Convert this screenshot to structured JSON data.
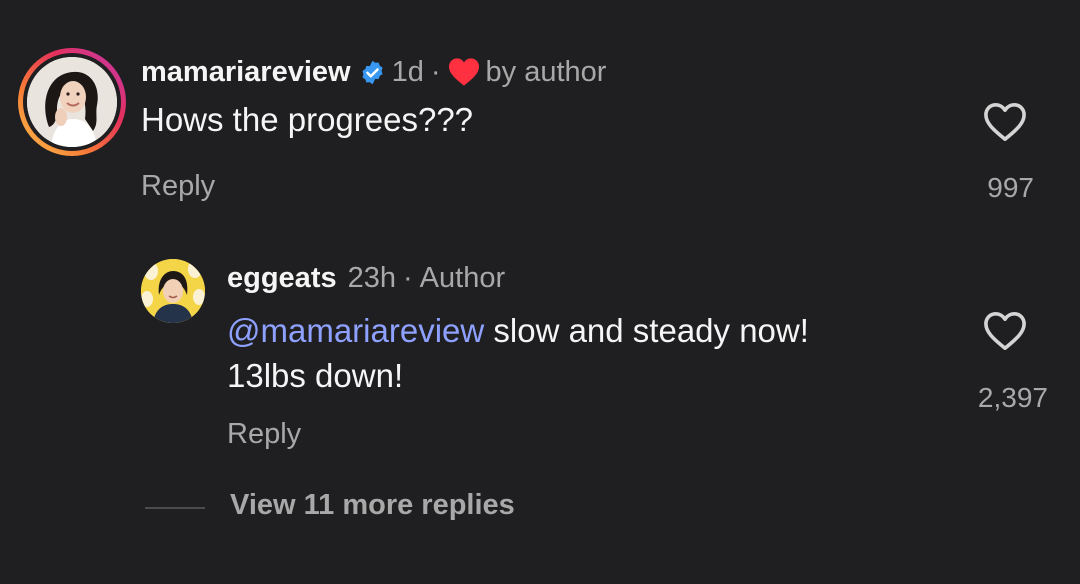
{
  "comment": {
    "username": "mamariareview",
    "verified_icon": "verified-badge-icon",
    "timestamp": "1d",
    "separator": "·",
    "liked_by_author": "by author",
    "text": "Hows the progrees???",
    "reply_label": "Reply",
    "like_count": "997",
    "avatar_ring_colors": [
      "#c13ab4",
      "#e4305c",
      "#f77737",
      "#fcc64b"
    ]
  },
  "reply": {
    "username": "eggeats",
    "timestamp": "23h",
    "separator": "·",
    "author_label": "Author",
    "mention": "@mamariareview",
    "text_line1": " slow and steady now!",
    "text_line2": "13lbs down!",
    "reply_label": "Reply",
    "like_count": "2,397",
    "mention_color": "#8ea1ff"
  },
  "view_more": {
    "label": "View 11 more replies"
  },
  "colors": {
    "background": "#1f1f21",
    "primary_text": "#f5f5f5",
    "secondary_text": "#a8a8a8",
    "verified_blue": "#3897f0",
    "heart_red": "#ff3040"
  }
}
